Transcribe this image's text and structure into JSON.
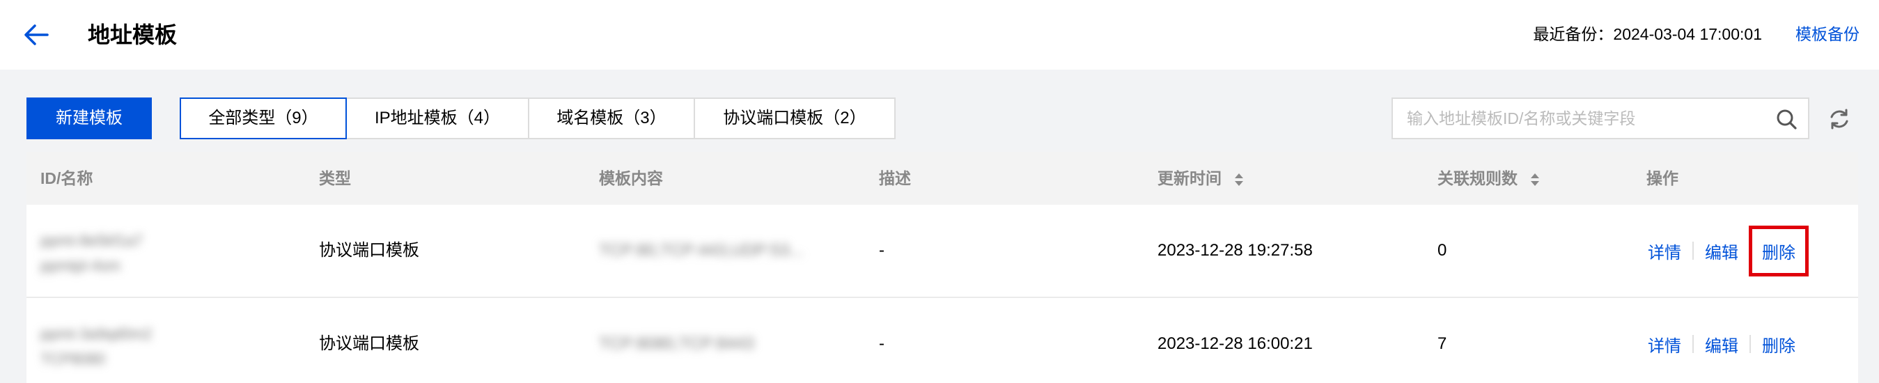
{
  "header": {
    "title": "地址模板",
    "backup_label": "最近备份：2024-03-04 17:00:01",
    "backup_link": "模板备份"
  },
  "toolbar": {
    "new_button": "新建模板",
    "tabs": [
      {
        "label": "全部类型（9）",
        "active": true
      },
      {
        "label": "IP地址模板（4）",
        "active": false
      },
      {
        "label": "域名模板（3）",
        "active": false
      },
      {
        "label": "协议端口模板（2）",
        "active": false
      }
    ],
    "search_placeholder": "输入地址模板ID/名称或关键字段"
  },
  "table": {
    "columns": [
      "ID/名称",
      "类型",
      "模板内容",
      "描述",
      "更新时间",
      "关联规则数",
      "操作"
    ],
    "rows": [
      {
        "id": "ppmt-8e5kf1a7",
        "name": "ppmtpl-4sm",
        "type": "协议端口模板",
        "content": "TCP:80,TCP:443,UDP:53...",
        "description": "-",
        "updated": "2023-12-28 19:27:58",
        "rules": "0",
        "actions": [
          "详情",
          "编辑",
          "删除"
        ]
      },
      {
        "id": "ppmt-3a9qd0m2",
        "name": "TCP8080",
        "type": "协议端口模板",
        "content": "TCP:8080,TCP:8443",
        "description": "-",
        "updated": "2023-12-28 16:00:21",
        "rules": "7",
        "actions": [
          "详情",
          "编辑",
          "删除"
        ]
      }
    ]
  },
  "colors": {
    "primary": "#0052d9",
    "highlight": "#e0000b",
    "page_bg": "#f2f3f5",
    "header_text": "#888888"
  }
}
